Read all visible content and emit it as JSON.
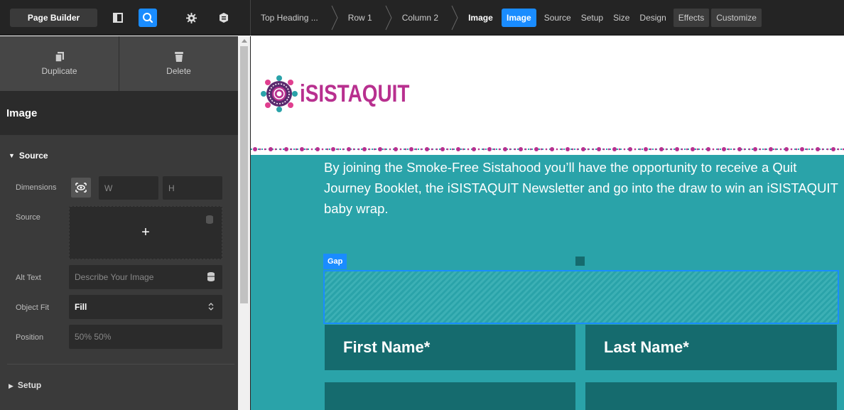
{
  "toolbar": {
    "brand_label": "Page Builder",
    "icons": [
      "layout-icon",
      "search-icon",
      "gear-icon",
      "layers-icon"
    ],
    "breadcrumbs": [
      "Top Heading ...",
      "Row 1",
      "Column 2",
      "Image"
    ],
    "tabs": {
      "active": "Image",
      "items": [
        "Source",
        "Setup",
        "Size",
        "Design"
      ],
      "boxed": [
        "Effects",
        "Customize"
      ]
    },
    "accent_color": "#1a8cff"
  },
  "panel": {
    "duplicate_label": "Duplicate",
    "delete_label": "Delete",
    "title": "Image",
    "source_section": "Source",
    "dimensions_label": "Dimensions",
    "width_placeholder": "W",
    "height_placeholder": "H",
    "source_label": "Source",
    "add_symbol": "+",
    "alt_text_label": "Alt Text",
    "alt_text_placeholder": "Describe Your Image",
    "object_fit_label": "Object Fit",
    "object_fit_value": "Fill",
    "position_label": "Position",
    "position_placeholder": "50% 50%",
    "setup_section": "Setup"
  },
  "canvas": {
    "logo_text": "iSISTAQUIT",
    "intro_text": "By joining the Smoke-Free Sistahood you’ll have the opportunity to receive a Quit Journey Booklet, the iSISTAQUIT Newsletter and go into the draw to win an iSISTAQUIT baby wrap.",
    "gap_label": "Gap",
    "first_name_label": "First Name*",
    "last_name_label": "Last Name*",
    "colors": {
      "brand_magenta": "#b8308f",
      "teal_bg": "#2aa3a9",
      "field_bg": "#156b6e"
    }
  }
}
